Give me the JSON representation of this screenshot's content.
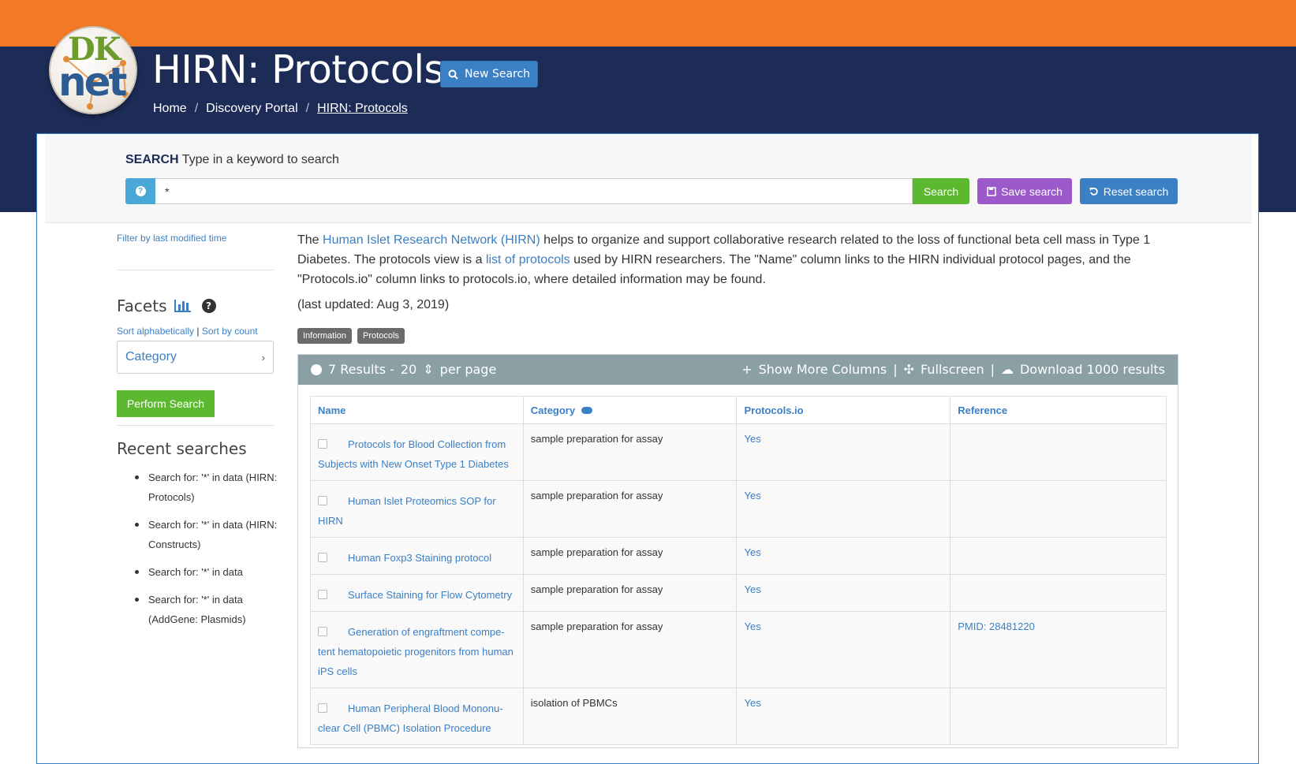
{
  "app": {
    "title": "HIRN: Protocols",
    "logo_text_top": "DK",
    "logo_text_bottom": "net",
    "new_search_label": "New Search"
  },
  "breadcrumb": {
    "items": [
      "Home",
      "Discovery Portal",
      "HIRN: Protocols"
    ],
    "separator": "/"
  },
  "search": {
    "label_strong": "SEARCH",
    "label_hint": "Type in a keyword to search",
    "value": "*",
    "help_icon": "question-circle-icon",
    "search_button": "Search",
    "save_button": "Save search",
    "reset_button": "Reset search"
  },
  "sidebar": {
    "filter_link": "Filter by last modified time",
    "facets_title": "Facets",
    "sort_alpha": "Sort alphabetically",
    "sort_sep": "|",
    "sort_count": "Sort by count",
    "category_facet": "Category",
    "perform_search": "Perform Search",
    "recent_title": "Recent searches",
    "recent": [
      "Search for: '*' in data (HIRN: Protocols)",
      "Search for: '*' in data (HIRN: Constructs)",
      "Search for: '*' in data",
      "Search for: '*' in data (AddGene: Plasmids)"
    ]
  },
  "main": {
    "desc_1": "The ",
    "desc_link_1": "Human Islet Research Network (HIRN)",
    "desc_2": " helps to organize and support collaborative research related to the loss of functional beta cell mass in Type 1 Diabetes. The protocols view is a ",
    "desc_link_2": "list of protocols",
    "desc_3": " used by HIRN researchers. The \"Name\" column links to the HIRN individual protocol pages, and the \"Protocols.io\" column links to protocols.io, where detailed information may be found.",
    "updated": "(last updated: Aug 3, 2019)",
    "tags": [
      "Information",
      "Protocols"
    ],
    "results_count": "7 Results -",
    "per_page_value": "20",
    "per_page_label": "per page",
    "show_more": "Show More Columns",
    "fullscreen": "Fullscreen",
    "download": "Download 1000 results",
    "bar_sep": "|"
  },
  "table": {
    "headers": [
      "Name",
      "Category",
      "Protocols.io",
      "Reference"
    ],
    "rows": [
      {
        "name": "Protocols for Blood Collection from Subjects with New Onset Type 1 Diabetes",
        "category": "sample preparation for assay",
        "protocols_io": "Yes",
        "reference": ""
      },
      {
        "name": "Human Islet Proteomics SOP for HIRN",
        "category": "sample preparation for assay",
        "protocols_io": "Yes",
        "reference": ""
      },
      {
        "name": "Human Foxp3 Staining protocol",
        "category": "sample preparation for assay",
        "protocols_io": "Yes",
        "reference": ""
      },
      {
        "name": "Surface Staining for Flow Cytometry",
        "category": "sample preparation for assay",
        "protocols_io": "Yes",
        "reference": ""
      },
      {
        "name": "Generation of engraftment compe-tent hematopoietic progenitors from human iPS cells",
        "category": "sample preparation for assay",
        "protocols_io": "Yes",
        "reference": "PMID: 28481220"
      },
      {
        "name": "Human Peripheral Blood Mononu-clear Cell (PBMC) Isolation Procedure",
        "category": "isolation of PBMCs",
        "protocols_io": "Yes",
        "reference": ""
      }
    ]
  }
}
